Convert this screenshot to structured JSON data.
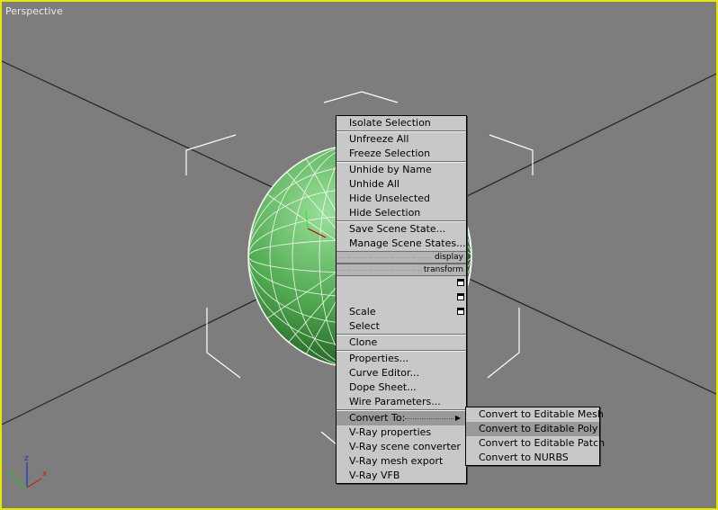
{
  "viewport": {
    "label": "Perspective",
    "border_color": "#e6e600",
    "background": "#7d7d7d"
  },
  "axis": {
    "x": "x",
    "y": "y",
    "z": "z"
  },
  "quad_menu": {
    "sections": [
      {
        "items": [
          "Isolate Selection"
        ]
      },
      {
        "items": [
          "Unfreeze All",
          "Freeze Selection"
        ]
      },
      {
        "items": [
          "Unhide by Name",
          "Unhide All",
          "Hide Unselected",
          "Hide Selection"
        ]
      },
      {
        "items": [
          "Save Scene State...",
          "Manage Scene States..."
        ]
      }
    ],
    "display_bar": "display",
    "transform_bar": "transform",
    "transform_items": [
      "",
      "",
      "",
      "Scale",
      "Select"
    ],
    "clone": "Clone",
    "edit_items": [
      "Properties...",
      "Curve Editor...",
      "Dope Sheet...",
      "Wire Parameters..."
    ],
    "convert_to": "Convert To:",
    "vray_items": [
      "V-Ray properties",
      "V-Ray scene converter",
      "V-Ray mesh export",
      "V-Ray VFB"
    ]
  },
  "convert_submenu": {
    "items": [
      "Convert to Editable Mesh",
      "Convert to Editable Poly",
      "Convert to Editable Patch",
      "Convert to NURBS"
    ],
    "highlighted_index": 1
  },
  "sphere_color": "#4fa84f",
  "icons": [
    "box-icon",
    "submenu-arrow-icon"
  ]
}
